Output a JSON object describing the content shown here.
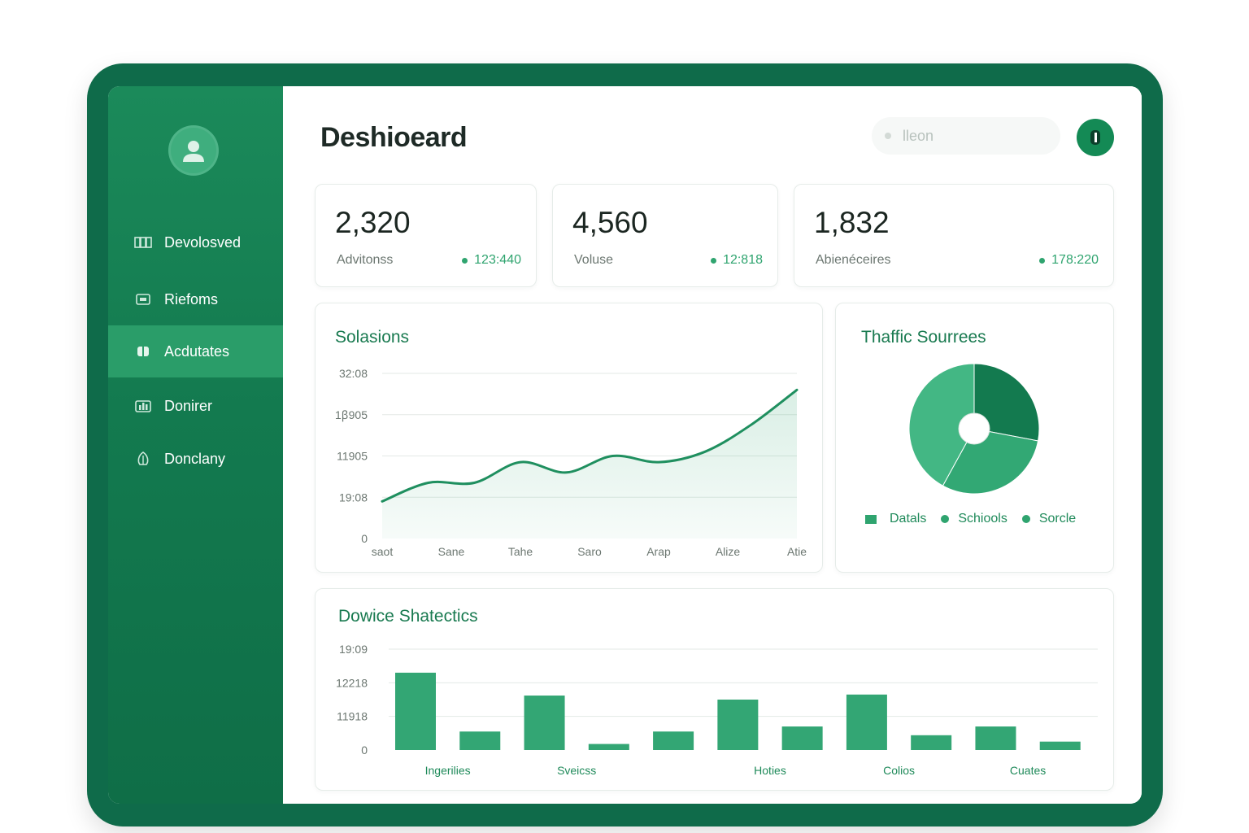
{
  "app": {
    "page_title": "Deshioeard",
    "search": {
      "placeholder": "lleon"
    }
  },
  "sidebar": {
    "items": [
      {
        "label": "Devolosved",
        "icon": "columns-icon",
        "active": false
      },
      {
        "label": "Riefoms",
        "icon": "folder-icon",
        "active": false
      },
      {
        "label": "Acdutates",
        "icon": "tag-icon",
        "active": true
      },
      {
        "label": "Donirer",
        "icon": "bar-chart-icon",
        "active": false
      },
      {
        "label": "Donclany",
        "icon": "leaf-icon",
        "active": false
      }
    ]
  },
  "stats": [
    {
      "value": "2,320",
      "label": "Advitonss",
      "delta": "123:440"
    },
    {
      "value": "4,560",
      "label": "Voluse",
      "delta": "12:818"
    },
    {
      "value": "1,832",
      "label": "Abienéceires",
      "delta": "178:220"
    }
  ],
  "colors": {
    "device": "#0f6b4a",
    "sidebar": "#137a4f",
    "active_item": "#2a9d69",
    "accent": "#2fa46f",
    "dark_slice": "#137a4f"
  },
  "chart_data": [
    {
      "type": "area",
      "title": "Solasions",
      "y_ticks": [
        "32:08",
        "1ꞵ905",
        "11905",
        "19:08",
        "0"
      ],
      "categories": [
        "saot",
        "Sane",
        "Tahe",
        "Saro",
        "Arap",
        "Alize",
        "Atie"
      ],
      "series": [
        {
          "values": [
            0.9,
            1.35,
            1.35,
            1.85,
            1.6,
            2.0,
            1.85,
            2.1,
            2.75,
            3.6
          ]
        }
      ],
      "ylim": [
        0,
        4
      ],
      "grid": true
    },
    {
      "type": "pie",
      "title": "Thaffic Sourrees",
      "slices": [
        {
          "label": "Datals",
          "value": 28
        },
        {
          "label": "Schiools",
          "value": 30
        },
        {
          "label": "Sorcle",
          "value": 42
        }
      ],
      "legend": [
        "Datals",
        "Schiools",
        "Sorcle"
      ]
    },
    {
      "type": "bar",
      "title": "Dowice Shatectics",
      "y_ticks": [
        "19:09",
        "12218",
        "11918",
        "0"
      ],
      "categories": [
        "Ingerilies",
        "Sveicss",
        "Hoties",
        "Colios",
        "Cuates"
      ],
      "values": [
        2.3,
        0.55,
        1.62,
        0.18,
        0.55,
        1.5,
        0.7,
        1.65,
        0.44,
        0.7,
        0.25
      ],
      "ylim": [
        0,
        3
      ],
      "grid": true
    }
  ]
}
